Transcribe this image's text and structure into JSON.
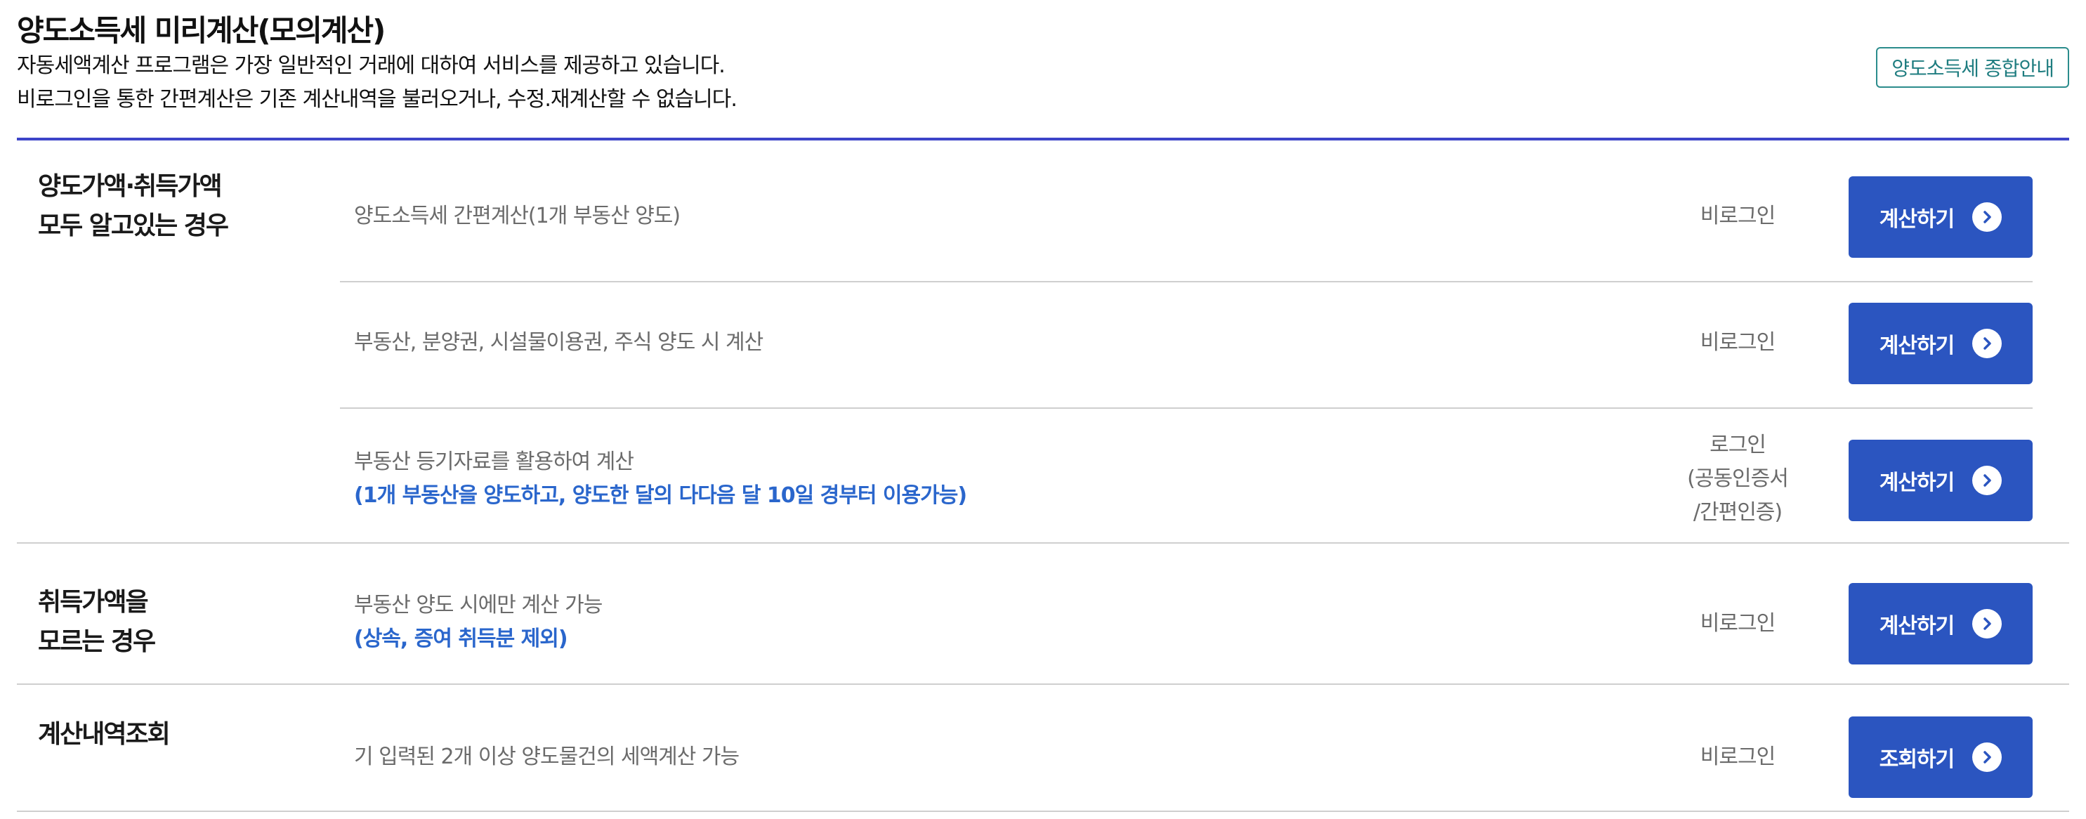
{
  "header": {
    "title": "양도소득세 미리계산(모의계산)",
    "desc_line1": "자동세액계산 프로그램은 가장 일반적인 거래에 대하여 서비스를 제공하고 있습니다.",
    "desc_line2": "비로그인을 통한 간편계산은 기존 계산내역을 불러오거나, 수정.재계산할 수 없습니다.",
    "guide_button": "양도소득세 종합안내"
  },
  "colors": {
    "accent_line": "#3d45c9",
    "button_bg": "#2b55c0",
    "note_text": "#2a66cc",
    "guide_border": "#2b8c8c"
  },
  "sections": [
    {
      "category_line1": "양도가액·취득가액",
      "category_line2": "모두 알고있는 경우",
      "rows": [
        {
          "desc": "양도소득세 간편계산(1개 부동산 양도)",
          "login": "비로그인",
          "button": "계산하기"
        },
        {
          "desc": "부동산, 분양권, 시설물이용권, 주식 양도 시 계산",
          "login": "비로그인",
          "button": "계산하기"
        },
        {
          "desc": "부동산 등기자료를 활용하여 계산",
          "note": "(1개 부동산을 양도하고, 양도한 달의 다다음 달 10일 경부터 이용가능)",
          "login_line1": "로그인",
          "login_line2": "(공동인증서",
          "login_line3": "/간편인증)",
          "button": "계산하기"
        }
      ]
    },
    {
      "category_line1": "취득가액을",
      "category_line2": "모르는 경우",
      "rows": [
        {
          "desc": "부동산 양도 시에만 계산 가능",
          "note": "(상속, 증여 취득분 제외)",
          "login": "비로그인",
          "button": "계산하기"
        }
      ]
    },
    {
      "category_line1": "계산내역조회",
      "rows": [
        {
          "desc": "기 입력된 2개 이상 양도물건의 세액계산 가능",
          "login": "비로그인",
          "button": "조회하기"
        }
      ]
    }
  ],
  "icons": {
    "button_icon": "chevron-right-circle-icon"
  }
}
